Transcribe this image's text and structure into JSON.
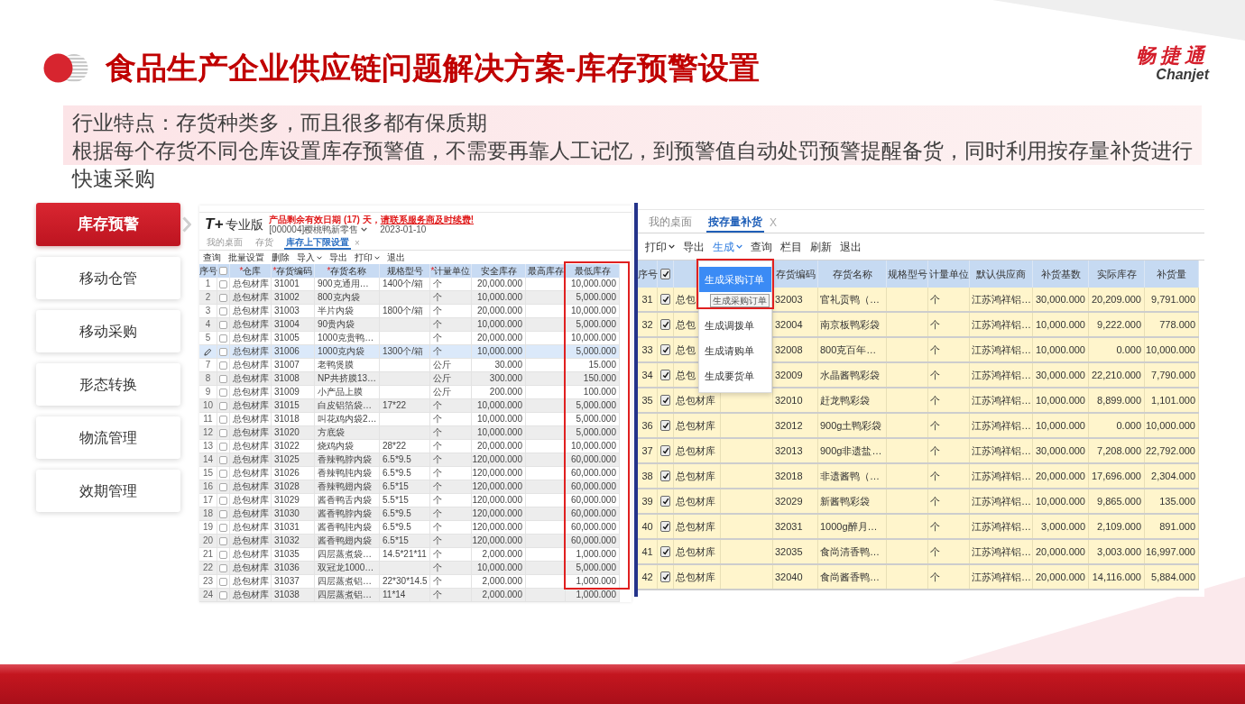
{
  "header": {
    "title": "食品生产企业供应链问题解决方案-库存预警设置",
    "brand_cn": "畅捷通",
    "brand_en": "Chanjet"
  },
  "intro": {
    "feature": "行业特点：存货种类多，而且很多都有保质期",
    "description": "根据每个存货不同仓库设置库存预警值，不需要再靠人工记忆，到预警值自动处罚预警提醒备货，同时利用按存量补货进行快速采购"
  },
  "side_menu": [
    {
      "label": "库存预警",
      "selected": true
    },
    {
      "label": "移动仓管",
      "selected": false
    },
    {
      "label": "移动采购",
      "selected": false
    },
    {
      "label": "形态转换",
      "selected": false
    },
    {
      "label": "物流管理",
      "selected": false
    },
    {
      "label": "效期管理",
      "selected": false
    }
  ],
  "left_screen": {
    "logo": "T+",
    "edition": "专业版",
    "notice": "产品剩余有效日期 (17) 天，",
    "notice_link": "请联系服务商及时续费!",
    "account": "[000004]樱桃鸭新零售",
    "date": "2023-01-10",
    "tabs": [
      {
        "label": "我的桌面",
        "selected": false
      },
      {
        "label": "存货",
        "selected": false
      },
      {
        "label": "库存上下限设置",
        "selected": true,
        "close": "×"
      }
    ],
    "toolbar": [
      {
        "label": "查询"
      },
      {
        "label": "批量设置"
      },
      {
        "label": "删除"
      },
      {
        "label": "导入",
        "dropdown": true
      },
      {
        "label": "导出"
      },
      {
        "label": "打印",
        "dropdown": true
      },
      {
        "label": "退出"
      }
    ],
    "table": {
      "select_all": false,
      "columns": [
        {
          "label": "序号"
        },
        {
          "mark": "*",
          "label": "仓库"
        },
        {
          "mark": "*",
          "label": "存货编码"
        },
        {
          "mark": "*",
          "label": "存货名称"
        },
        {
          "label": "规格型号"
        },
        {
          "mark": "*",
          "label": "计量单位"
        },
        {
          "label": "安全库存"
        },
        {
          "label": "最高库存"
        },
        {
          "label": "最低库存"
        }
      ],
      "rows": [
        {
          "seq": "1",
          "checked": false,
          "selected": false,
          "warehouse": "总包材库",
          "code": "31001",
          "name": "900克通用…",
          "spec": "1400个/箱",
          "unit": "个",
          "safety": "20,000.000",
          "low": "10,000.000"
        },
        {
          "seq": "2",
          "checked": false,
          "selected": false,
          "warehouse": "总包材库",
          "code": "31002",
          "name": "800克内袋",
          "unit": "个",
          "safety": "10,000.000",
          "low": "5,000.000"
        },
        {
          "seq": "3",
          "checked": false,
          "selected": false,
          "warehouse": "总包材库",
          "code": "31003",
          "name": "半片内袋",
          "spec": "1800个/箱",
          "unit": "个",
          "safety": "20,000.000",
          "low": "10,000.000"
        },
        {
          "seq": "4",
          "checked": false,
          "selected": false,
          "warehouse": "总包材库",
          "code": "31004",
          "name": "90贵内袋",
          "unit": "个",
          "safety": "10,000.000",
          "low": "5,000.000"
        },
        {
          "seq": "5",
          "checked": false,
          "selected": false,
          "warehouse": "总包材库",
          "code": "31005",
          "name": "1000克贵鸭…",
          "unit": "个",
          "safety": "20,000.000",
          "low": "10,000.000"
        },
        {
          "checked": false,
          "selected": true,
          "warehouse": "总包材库",
          "code": "31006",
          "name": "1000克内袋",
          "spec": "1300个/箱",
          "unit": "个",
          "safety": "10,000.000",
          "low": "5,000.000"
        },
        {
          "seq": "7",
          "checked": false,
          "selected": false,
          "warehouse": "总包材库",
          "code": "31007",
          "name": "老鸭煲膜",
          "unit": "公斤",
          "safety": "30.000",
          "low": "15.000"
        },
        {
          "seq": "8",
          "checked": false,
          "selected": false,
          "warehouse": "总包材库",
          "code": "31008",
          "name": "NP共挤膜13…",
          "unit": "公斤",
          "safety": "300.000",
          "low": "150.000"
        },
        {
          "seq": "9",
          "checked": false,
          "selected": false,
          "warehouse": "总包材库",
          "code": "31009",
          "name": "小产品上膜",
          "unit": "公斤",
          "safety": "200.000",
          "low": "100.000"
        },
        {
          "seq": "10",
          "checked": false,
          "selected": false,
          "warehouse": "总包材库",
          "code": "31015",
          "name": "白皮铝箔袋…",
          "spec": "17*22",
          "unit": "个",
          "safety": "10,000.000",
          "low": "5,000.000"
        },
        {
          "seq": "11",
          "checked": false,
          "selected": false,
          "warehouse": "总包材库",
          "code": "31018",
          "name": "叫花鸡内袋2…",
          "unit": "个",
          "safety": "10,000.000",
          "low": "5,000.000"
        },
        {
          "seq": "12",
          "checked": false,
          "selected": false,
          "warehouse": "总包材库",
          "code": "31020",
          "name": "方底袋",
          "unit": "个",
          "safety": "10,000.000",
          "low": "5,000.000"
        },
        {
          "seq": "13",
          "checked": false,
          "selected": false,
          "warehouse": "总包材库",
          "code": "31022",
          "name": "烧鸡内袋",
          "spec": "28*22",
          "unit": "个",
          "safety": "20,000.000",
          "low": "10,000.000"
        },
        {
          "seq": "14",
          "checked": false,
          "selected": false,
          "warehouse": "总包材库",
          "code": "31025",
          "name": "香辣鸭脖内袋",
          "spec": "6.5*9.5",
          "unit": "个",
          "safety": "120,000.000",
          "low": "60,000.000"
        },
        {
          "seq": "15",
          "checked": false,
          "selected": false,
          "warehouse": "总包材库",
          "code": "31026",
          "name": "香辣鸭肫内袋",
          "spec": "6.5*9.5",
          "unit": "个",
          "safety": "120,000.000",
          "low": "60,000.000"
        },
        {
          "seq": "16",
          "checked": false,
          "selected": false,
          "warehouse": "总包材库",
          "code": "31028",
          "name": "香辣鸭翅内袋",
          "spec": "6.5*15",
          "unit": "个",
          "safety": "120,000.000",
          "low": "60,000.000"
        },
        {
          "seq": "17",
          "checked": false,
          "selected": false,
          "warehouse": "总包材库",
          "code": "31029",
          "name": "酱香鸭舌内袋",
          "spec": "5.5*15",
          "unit": "个",
          "safety": "120,000.000",
          "low": "60,000.000"
        },
        {
          "seq": "18",
          "checked": false,
          "selected": false,
          "warehouse": "总包材库",
          "code": "31030",
          "name": "酱香鸭脖内袋",
          "spec": "6.5*9.5",
          "unit": "个",
          "safety": "120,000.000",
          "low": "60,000.000"
        },
        {
          "seq": "19",
          "checked": false,
          "selected": false,
          "warehouse": "总包材库",
          "code": "31031",
          "name": "酱香鸭肫内袋",
          "spec": "6.5*9.5",
          "unit": "个",
          "safety": "120,000.000",
          "low": "60,000.000"
        },
        {
          "seq": "20",
          "checked": false,
          "selected": false,
          "warehouse": "总包材库",
          "code": "31032",
          "name": "酱香鸭翅内袋",
          "spec": "6.5*15",
          "unit": "个",
          "safety": "120,000.000",
          "low": "60,000.000"
        },
        {
          "seq": "21",
          "checked": false,
          "selected": false,
          "warehouse": "总包材库",
          "code": "31035",
          "name": "四层蒸煮袋…",
          "spec": "14.5*21*11",
          "unit": "个",
          "safety": "2,000.000",
          "low": "1,000.000"
        },
        {
          "seq": "22",
          "checked": false,
          "selected": false,
          "warehouse": "总包材库",
          "code": "31036",
          "name": "双冠龙1000…",
          "unit": "个",
          "safety": "10,000.000",
          "low": "5,000.000"
        },
        {
          "seq": "23",
          "checked": false,
          "selected": false,
          "warehouse": "总包材库",
          "code": "31037",
          "name": "四层蒸煮铝…",
          "spec": "22*30*14.5",
          "unit": "个",
          "safety": "2,000.000",
          "low": "1,000.000"
        },
        {
          "seq": "24",
          "checked": false,
          "selected": false,
          "warehouse": "总包材库",
          "code": "31038",
          "name": "四层蒸煮铝…",
          "spec": "11*14",
          "unit": "个",
          "safety": "2,000.000",
          "low": "1,000.000"
        }
      ]
    }
  },
  "right_screen": {
    "tabs": [
      {
        "label": "我的桌面",
        "selected": false
      },
      {
        "label": "按存量补货",
        "selected": true,
        "close": "X"
      }
    ],
    "toolbar": [
      {
        "label": "打印",
        "dropdown": true,
        "selected": false
      },
      {
        "label": "导出",
        "selected": false
      },
      {
        "label": "生成",
        "dropdown": true,
        "selected": true
      },
      {
        "label": "查询",
        "selected": false
      },
      {
        "label": "栏目",
        "selected": false
      },
      {
        "label": "刷新",
        "selected": false
      },
      {
        "label": "退出",
        "selected": false
      }
    ],
    "table": {
      "seq_header": "序号",
      "select_all": true,
      "columns": [
        "存货编码",
        "存货名称",
        "规格型号",
        "计量单位",
        "默认供应商",
        "补货基数",
        "实际库存",
        "补货量"
      ],
      "rows": [
        {
          "seq": "31",
          "checked": true,
          "warehouse": "总包",
          "code": "32003",
          "name": "官礼贡鸭（…",
          "unit": "个",
          "supplier": "江苏鸿祥铝…",
          "base": "30,000.000",
          "actual": "20,209.000",
          "qty": "9,791.000"
        },
        {
          "seq": "32",
          "checked": true,
          "warehouse": "总包",
          "code": "32004",
          "name": "南京板鸭彩袋",
          "unit": "个",
          "supplier": "江苏鸿祥铝…",
          "base": "10,000.000",
          "actual": "9,222.000",
          "qty": "778.000"
        },
        {
          "seq": "33",
          "checked": true,
          "warehouse": "总包",
          "code": "32008",
          "name": "800克百年…",
          "unit": "个",
          "supplier": "江苏鸿祥铝…",
          "base": "10,000.000",
          "actual": "0.000",
          "qty": "10,000.000"
        },
        {
          "seq": "34",
          "checked": true,
          "warehouse": "总包",
          "code": "32009",
          "name": "水晶酱鸭彩袋",
          "unit": "个",
          "supplier": "江苏鸿祥铝…",
          "base": "30,000.000",
          "actual": "22,210.000",
          "qty": "7,790.000"
        },
        {
          "seq": "35",
          "checked": true,
          "warehouse": "总包材库",
          "code": "32010",
          "name": "赶龙鸭彩袋",
          "unit": "个",
          "supplier": "江苏鸿祥铝…",
          "base": "10,000.000",
          "actual": "8,899.000",
          "qty": "1,101.000"
        },
        {
          "seq": "36",
          "checked": true,
          "warehouse": "总包材库",
          "code": "32012",
          "name": "900g土鸭彩袋",
          "unit": "个",
          "supplier": "江苏鸿祥铝…",
          "base": "10,000.000",
          "actual": "0.000",
          "qty": "10,000.000"
        },
        {
          "seq": "37",
          "checked": true,
          "warehouse": "总包材库",
          "code": "32013",
          "name": "900g非遗盐…",
          "unit": "个",
          "supplier": "江苏鸿祥铝…",
          "base": "30,000.000",
          "actual": "7,208.000",
          "qty": "22,792.000"
        },
        {
          "seq": "38",
          "checked": true,
          "warehouse": "总包材库",
          "code": "32018",
          "name": "非遗酱鸭（…",
          "unit": "个",
          "supplier": "江苏鸿祥铝…",
          "base": "20,000.000",
          "actual": "17,696.000",
          "qty": "2,304.000"
        },
        {
          "seq": "39",
          "checked": true,
          "warehouse": "总包材库",
          "code": "32029",
          "name": "新酱鸭彩袋",
          "unit": "个",
          "supplier": "江苏鸿祥铝…",
          "base": "10,000.000",
          "actual": "9,865.000",
          "qty": "135.000"
        },
        {
          "seq": "40",
          "checked": true,
          "warehouse": "总包材库",
          "code": "32031",
          "name": "1000g醉月…",
          "unit": "个",
          "supplier": "江苏鸿祥铝…",
          "base": "3,000.000",
          "actual": "2,109.000",
          "qty": "891.000"
        },
        {
          "seq": "41",
          "checked": true,
          "warehouse": "总包材库",
          "code": "32035",
          "name": "食尚清香鸭…",
          "unit": "个",
          "supplier": "江苏鸿祥铝…",
          "base": "20,000.000",
          "actual": "3,003.000",
          "qty": "16,997.000"
        },
        {
          "seq": "42",
          "checked": true,
          "warehouse": "总包材库",
          "code": "32040",
          "name": "食尚酱香鸭…",
          "unit": "个",
          "supplier": "江苏鸿祥铝…",
          "base": "20,000.000",
          "actual": "14,116.000",
          "qty": "5,884.000"
        }
      ]
    },
    "menu": {
      "items": [
        {
          "label": "生成采购订单",
          "selected": true
        },
        {
          "label": "生成调拨单",
          "selected": false
        },
        {
          "label": "生成请购单",
          "selected": false
        },
        {
          "label": "生成要货单",
          "selected": false
        }
      ],
      "tooltip": "生成采购订单"
    }
  }
}
